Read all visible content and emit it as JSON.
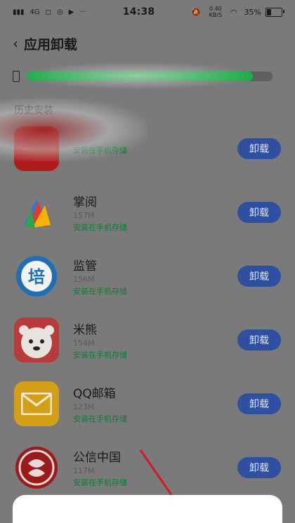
{
  "status": {
    "signal_text": "4G",
    "time": "14:38",
    "speed": "0.40 KB/S",
    "battery": "35%"
  },
  "header": {
    "title": "应用卸载"
  },
  "storage": {
    "used_fraction": 0.92
  },
  "section": {
    "label": "历史安装"
  },
  "apps": [
    {
      "name": "",
      "size": "",
      "location": "安装在手机存储",
      "button": "卸载",
      "icon": "redacted-app-icon"
    },
    {
      "name": "掌阅",
      "size": "157M",
      "location": "安装在手机存储",
      "button": "卸载",
      "icon": "zhangyue-icon"
    },
    {
      "name": "监管",
      "size": "156M",
      "location": "安装在手机存储",
      "button": "卸载",
      "icon": "jianguan-icon"
    },
    {
      "name": "米熊",
      "size": "154M",
      "location": "安装在手机存储",
      "button": "卸载",
      "icon": "mixiong-icon"
    },
    {
      "name": "QQ邮箱",
      "size": "123M",
      "location": "安装在手机存储",
      "button": "卸载",
      "icon": "qqmail-icon"
    },
    {
      "name": "公信中国",
      "size": "117M",
      "location": "安装在手机存储",
      "button": "卸载",
      "icon": "gongxin-icon"
    }
  ],
  "colors": {
    "accent_button": "#2f4fa0",
    "location_text": "#0d7a37",
    "storage_fill": "#1fae4b",
    "annotation_arrow": "#d11a2a"
  }
}
